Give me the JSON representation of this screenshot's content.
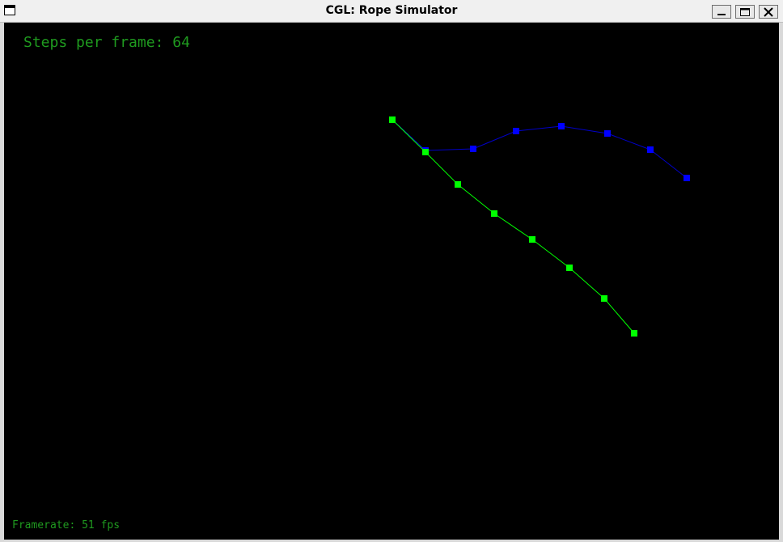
{
  "window": {
    "title": "CGL: Rope Simulator",
    "icon": "window-app-icon",
    "controls": [
      "minimize-icon",
      "maximize-icon",
      "close-icon"
    ]
  },
  "hud": {
    "steps_label": "Steps per frame: 64",
    "framerate_label": "Framerate: 51 fps"
  },
  "colors": {
    "background": "#000000",
    "text": "#1f9a1f",
    "green_rope": "#00ff00",
    "blue_rope": "#0000ff",
    "blue_rope_line": "#0000c8"
  }
}
